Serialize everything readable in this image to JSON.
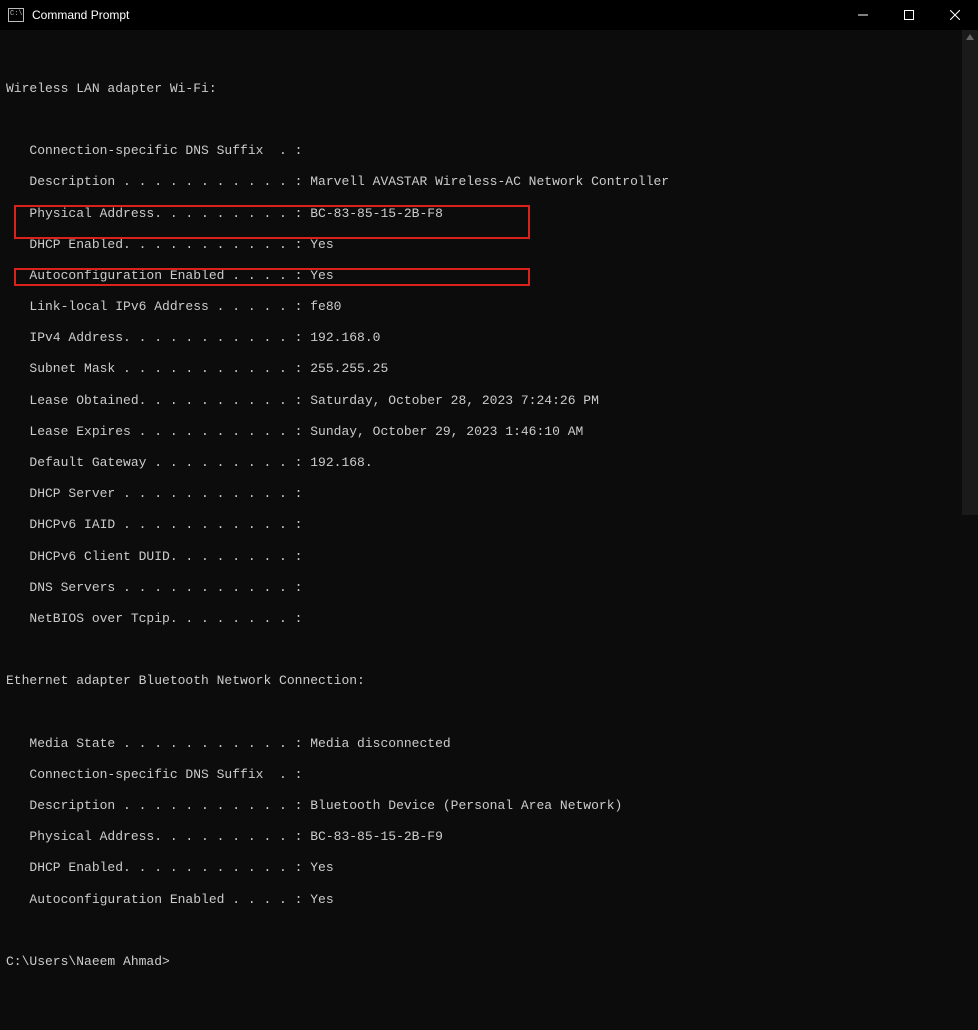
{
  "window": {
    "title": "Command Prompt"
  },
  "wifi": {
    "header": "Wireless LAN adapter Wi-Fi:",
    "dns_suffix_label": "   Connection-specific DNS Suffix  . :",
    "description_label": "   Description . . . . . . . . . . . : ",
    "description_value": "Marvell AVASTAR Wireless-AC Network Controller",
    "physical_label": "   Physical Address. . . . . . . . . : ",
    "physical_value": "BC-83-85-15-2B-F8",
    "dhcp_enabled_label": "   DHCP Enabled. . . . . . . . . . . : ",
    "dhcp_enabled_value": "Yes",
    "autoconf_label": "   Autoconfiguration Enabled . . . . : ",
    "autoconf_value": "Yes",
    "linklocal_label": "   Link-local IPv6 Address . . . . . : ",
    "linklocal_value": "fe80",
    "ipv4_label": "   IPv4 Address. . . . . . . . . . . : ",
    "ipv4_value": "192.168.0",
    "subnet_label": "   Subnet Mask . . . . . . . . . . . : ",
    "subnet_value": "255.255.25",
    "lease_obtained_label": "   Lease Obtained. . . . . . . . . . : ",
    "lease_obtained_value": "Saturday, October 28, 2023 7:24:26 PM",
    "lease_expires_label": "   Lease Expires . . . . . . . . . . : ",
    "lease_expires_value": "Sunday, October 29, 2023 1:46:10 AM",
    "gateway_label": "   Default Gateway . . . . . . . . . : ",
    "gateway_value": "192.168.",
    "dhcp_server_label": "   DHCP Server . . . . . . . . . . . : ",
    "dhcpv6_iaid_label": "   DHCPv6 IAID . . . . . . . . . . . : ",
    "dhcpv6_duid_label": "   DHCPv6 Client DUID. . . . . . . . : ",
    "dns_servers_label": "   DNS Servers . . . . . . . . . . . : ",
    "netbios_label": "   NetBIOS over Tcpip. . . . . . . . : "
  },
  "bluetooth": {
    "header": "Ethernet adapter Bluetooth Network Connection:",
    "media_state_label": "   Media State . . . . . . . . . . . : ",
    "media_state_value": "Media disconnected",
    "dns_suffix_label": "   Connection-specific DNS Suffix  . :",
    "description_label": "   Description . . . . . . . . . . . : ",
    "description_value": "Bluetooth Device (Personal Area Network)",
    "physical_label": "   Physical Address. . . . . . . . . : ",
    "physical_value": "BC-83-85-15-2B-F9",
    "dhcp_enabled_label": "   DHCP Enabled. . . . . . . . . . . : ",
    "dhcp_enabled_value": "Yes",
    "autoconf_label": "   Autoconfiguration Enabled . . . . : ",
    "autoconf_value": "Yes"
  },
  "prompt": "C:\\Users\\Naeem Ahmad>"
}
